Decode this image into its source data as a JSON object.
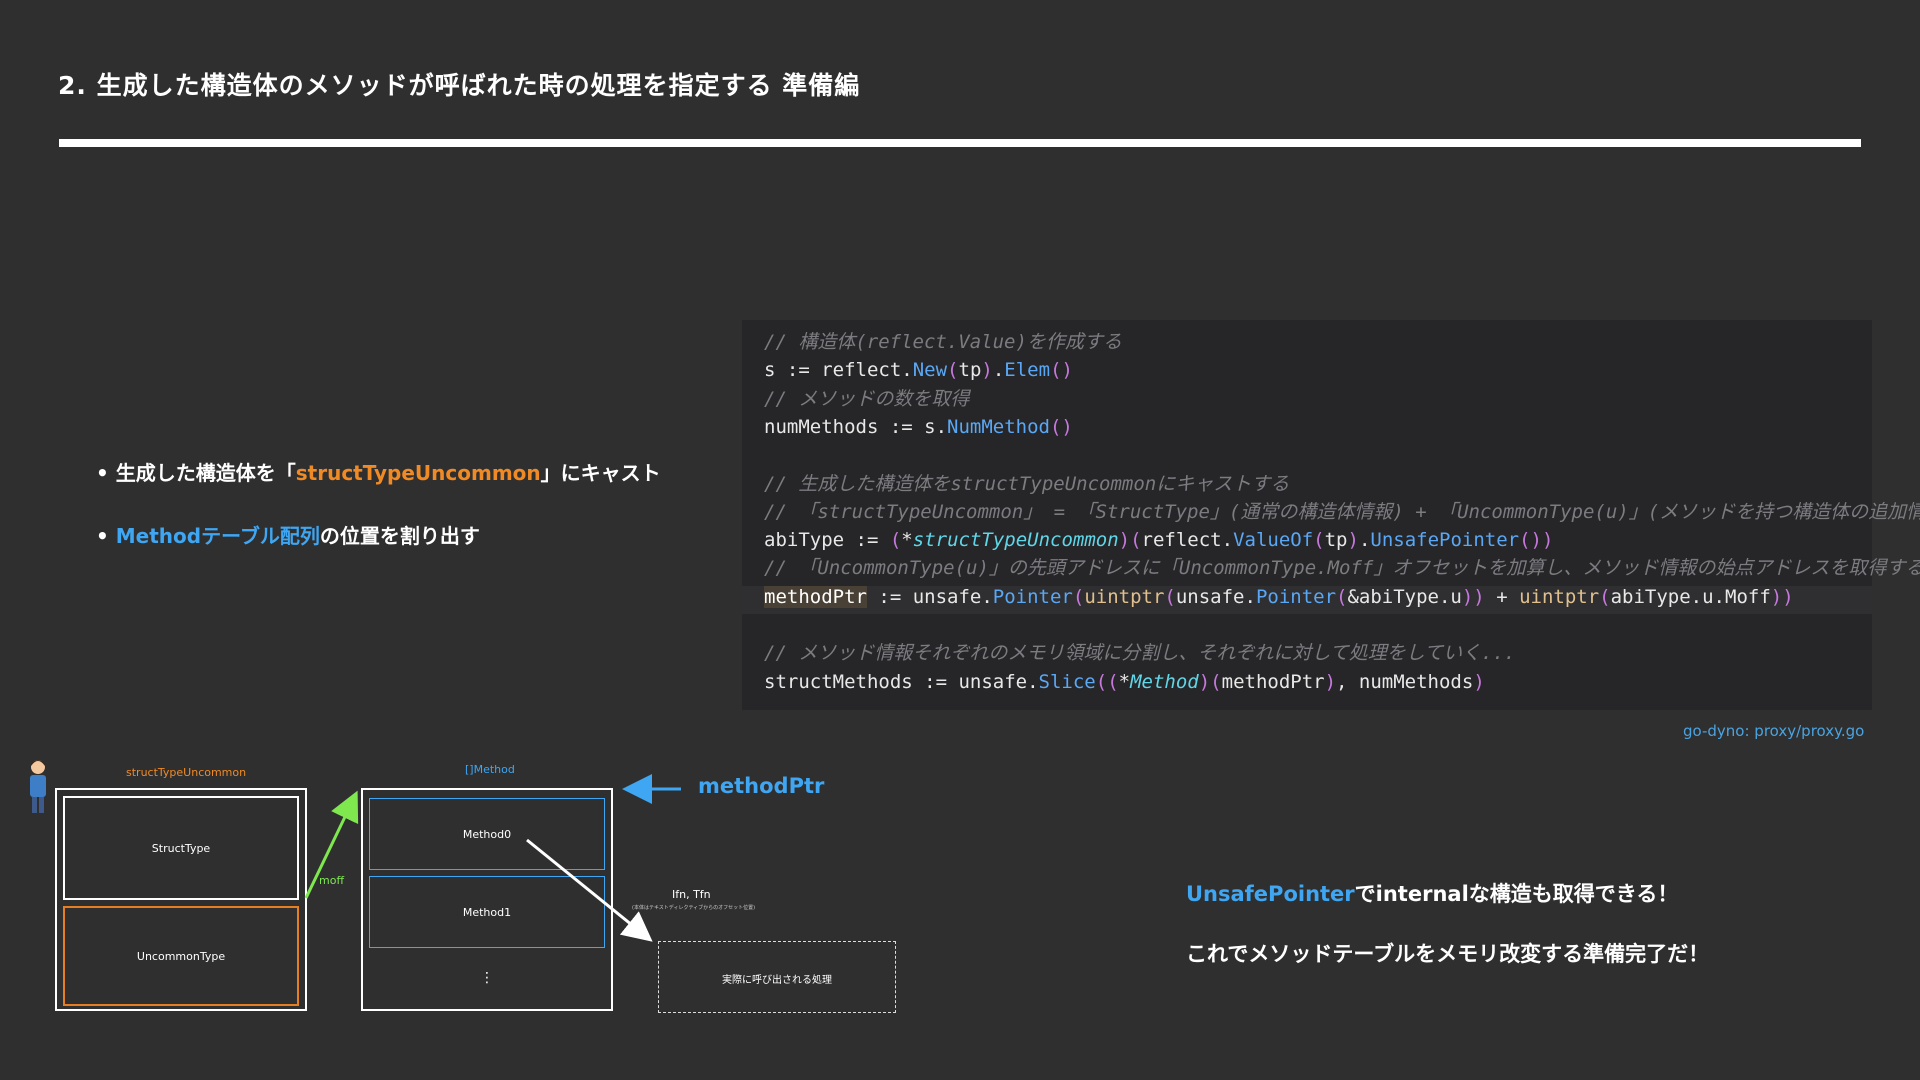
{
  "slide": {
    "title": "2. 生成した構造体のメソッドが呼ばれた時の処理を指定する 準備編"
  },
  "bullets": [
    {
      "pre": "• 生成した構造体を「",
      "hl": "structTypeUncommon",
      "post": "」にキャスト"
    },
    {
      "pre": "• ",
      "hl": "Methodテーブル配列",
      "post": "の位置を割り出す"
    }
  ],
  "code": {
    "lines": [
      [
        {
          "t": "// 構造体(reflect.Value)を作成する",
          "c": "com"
        }
      ],
      [
        {
          "t": "s := reflect.",
          "c": "plain"
        },
        {
          "t": "New",
          "c": "fn"
        },
        {
          "t": "(",
          "c": "par"
        },
        {
          "t": "tp",
          "c": "plain"
        },
        {
          "t": ")",
          "c": "par"
        },
        {
          "t": ".",
          "c": "plain"
        },
        {
          "t": "Elem",
          "c": "fn"
        },
        {
          "t": "()",
          "c": "par"
        }
      ],
      [
        {
          "t": "// メソッドの数を取得",
          "c": "com"
        }
      ],
      [
        {
          "t": "numMethods := s.",
          "c": "plain"
        },
        {
          "t": "NumMethod",
          "c": "fn"
        },
        {
          "t": "()",
          "c": "par"
        }
      ],
      [],
      [
        {
          "t": "// 生成した構造体をstructTypeUncommonにキャストする",
          "c": "com"
        }
      ],
      [
        {
          "t": "// 「structTypeUncommon」 = 「StructType」(通常の構造体情報) + 「UncommonType(u)」(メソッドを持つ構造体の追加情報)",
          "c": "com"
        }
      ],
      [
        {
          "t": "abiType := ",
          "c": "plain"
        },
        {
          "t": "(",
          "c": "par"
        },
        {
          "t": "*",
          "c": "plain"
        },
        {
          "t": "structTypeUncommon",
          "c": "ty"
        },
        {
          "t": ")(",
          "c": "par"
        },
        {
          "t": "reflect.",
          "c": "plain"
        },
        {
          "t": "ValueOf",
          "c": "fn"
        },
        {
          "t": "(",
          "c": "par"
        },
        {
          "t": "tp",
          "c": "plain"
        },
        {
          "t": ")",
          "c": "par"
        },
        {
          "t": ".",
          "c": "plain"
        },
        {
          "t": "UnsafePointer",
          "c": "fn"
        },
        {
          "t": "())",
          "c": "par"
        }
      ],
      [
        {
          "t": "// 「UncommonType(u)」の先頭アドレスに「UncommonType.Moff」オフセットを加算し、メソッド情報の始点アドレスを取得する",
          "c": "com"
        }
      ],
      [
        {
          "t": "methodPtr",
          "c": "hlvar"
        },
        {
          "t": " := unsafe.",
          "c": "plain"
        },
        {
          "t": "Pointer",
          "c": "fn"
        },
        {
          "t": "(",
          "c": "par"
        },
        {
          "t": "uintptr",
          "c": "kw"
        },
        {
          "t": "(",
          "c": "par"
        },
        {
          "t": "unsafe.",
          "c": "plain"
        },
        {
          "t": "Pointer",
          "c": "fn"
        },
        {
          "t": "(",
          "c": "par"
        },
        {
          "t": "&abiType.u",
          "c": "plain"
        },
        {
          "t": "))",
          "c": "par"
        },
        {
          "t": " + ",
          "c": "plain"
        },
        {
          "t": "uintptr",
          "c": "kw"
        },
        {
          "t": "(",
          "c": "par"
        },
        {
          "t": "abiType.u.Moff",
          "c": "plain"
        },
        {
          "t": "))",
          "c": "par"
        }
      ],
      [],
      [
        {
          "t": "// メソッド情報それぞれのメモリ領域に分割し、それぞれに対して処理をしていく...",
          "c": "com"
        }
      ],
      [
        {
          "t": "structMethods := unsafe.",
          "c": "plain"
        },
        {
          "t": "Slice",
          "c": "fn"
        },
        {
          "t": "((",
          "c": "par"
        },
        {
          "t": "*",
          "c": "plain"
        },
        {
          "t": "Method",
          "c": "ty"
        },
        {
          "t": ")(",
          "c": "par"
        },
        {
          "t": "methodPtr",
          "c": "plain"
        },
        {
          "t": ")",
          "c": "par"
        },
        {
          "t": ", numMethods",
          "c": "plain"
        },
        {
          "t": ")",
          "c": "par"
        }
      ]
    ]
  },
  "source_ref": "go-dyno: proxy/proxy.go",
  "diagram": {
    "left_label": "structTypeUncommon",
    "struct_type": "StructType",
    "uncommon_type": "UncommonType",
    "moff": "moff",
    "array_label": "[]Method",
    "method0": "Method0",
    "method1": "Method1",
    "ellipsis": "⋮",
    "method_ptr": "methodPtr",
    "ifn_tfn": "Ifn, Tfn",
    "ifn_note": "(本体はテキストディレクティブからのオフセット位置)",
    "actual": "実際に呼び出される処理"
  },
  "right": {
    "line1_hl": "UnsafePointer",
    "line1_mid": "で",
    "line1_hl2": "internal",
    "line1_post": "な構造も取得できる！",
    "line2": "これでメソッドテーブルをメモリ改変する準備完了だ！"
  },
  "colors": {
    "background": "#2f2f30",
    "accent_orange": "#f08a24",
    "accent_blue": "#3ea6f2",
    "arrow_green": "#7ee84e"
  }
}
